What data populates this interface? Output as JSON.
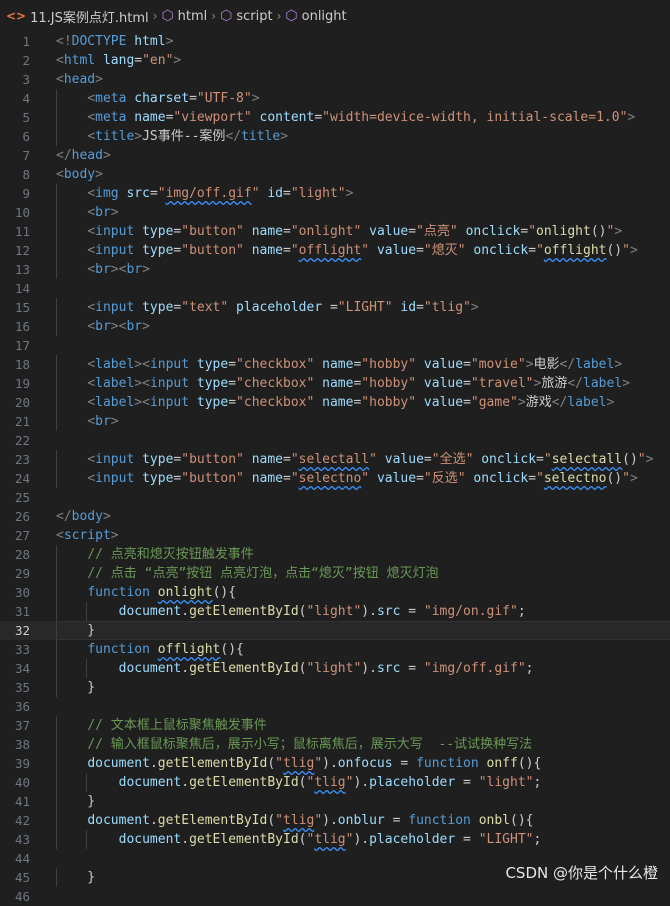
{
  "breadcrumb": {
    "file": "11.JS案例点灯.html",
    "items": [
      "html",
      "script",
      "onlight"
    ]
  },
  "lines": [
    [
      [
        "p",
        "<!"
      ],
      [
        "t",
        "DOCTYPE"
      ],
      [
        "d",
        " "
      ],
      [
        "a",
        "html"
      ],
      [
        "p",
        ">"
      ]
    ],
    [
      [
        "p",
        "<"
      ],
      [
        "t",
        "html"
      ],
      [
        "d",
        " "
      ],
      [
        "a",
        "lang"
      ],
      [
        "d",
        "="
      ],
      [
        "s",
        "\"en\""
      ],
      [
        "p",
        ">"
      ]
    ],
    [
      [
        "p",
        "<"
      ],
      [
        "t",
        "head"
      ],
      [
        "p",
        ">"
      ]
    ],
    [
      [
        "d",
        "    "
      ],
      [
        "p",
        "<"
      ],
      [
        "t",
        "meta"
      ],
      [
        "d",
        " "
      ],
      [
        "a",
        "charset"
      ],
      [
        "d",
        "="
      ],
      [
        "s",
        "\"UTF-8\""
      ],
      [
        "p",
        ">"
      ]
    ],
    [
      [
        "d",
        "    "
      ],
      [
        "p",
        "<"
      ],
      [
        "t",
        "meta"
      ],
      [
        "d",
        " "
      ],
      [
        "a",
        "name"
      ],
      [
        "d",
        "="
      ],
      [
        "s",
        "\"viewport\""
      ],
      [
        "d",
        " "
      ],
      [
        "a",
        "content"
      ],
      [
        "d",
        "="
      ],
      [
        "s",
        "\"width=device-width, initial-scale=1.0\""
      ],
      [
        "p",
        ">"
      ]
    ],
    [
      [
        "d",
        "    "
      ],
      [
        "p",
        "<"
      ],
      [
        "t",
        "title"
      ],
      [
        "p",
        ">"
      ],
      [
        "d",
        "JS事件--案例"
      ],
      [
        "p",
        "</"
      ],
      [
        "t",
        "title"
      ],
      [
        "p",
        ">"
      ]
    ],
    [
      [
        "p",
        "</"
      ],
      [
        "t",
        "head"
      ],
      [
        "p",
        ">"
      ]
    ],
    [
      [
        "p",
        "<"
      ],
      [
        "t",
        "body"
      ],
      [
        "p",
        ">"
      ]
    ],
    [
      [
        "d",
        "    "
      ],
      [
        "p",
        "<"
      ],
      [
        "t",
        "img"
      ],
      [
        "d",
        " "
      ],
      [
        "a",
        "src"
      ],
      [
        "d",
        "="
      ],
      [
        "s",
        "\""
      ],
      [
        "s sq",
        "img/off.gif"
      ],
      [
        "s",
        "\""
      ],
      [
        "d",
        " "
      ],
      [
        "a",
        "id"
      ],
      [
        "d",
        "="
      ],
      [
        "s",
        "\"light\""
      ],
      [
        "p",
        ">"
      ]
    ],
    [
      [
        "d",
        "    "
      ],
      [
        "p",
        "<"
      ],
      [
        "t",
        "br"
      ],
      [
        "p",
        ">"
      ]
    ],
    [
      [
        "d",
        "    "
      ],
      [
        "p",
        "<"
      ],
      [
        "t",
        "input"
      ],
      [
        "d",
        " "
      ],
      [
        "a",
        "type"
      ],
      [
        "d",
        "="
      ],
      [
        "s",
        "\"button\""
      ],
      [
        "d",
        " "
      ],
      [
        "a",
        "name"
      ],
      [
        "d",
        "="
      ],
      [
        "s",
        "\"onlight\""
      ],
      [
        "d",
        " "
      ],
      [
        "a",
        "value"
      ],
      [
        "d",
        "="
      ],
      [
        "s",
        "\"点亮\""
      ],
      [
        "d",
        " "
      ],
      [
        "a",
        "onclick"
      ],
      [
        "d",
        "="
      ],
      [
        "s",
        "\""
      ],
      [
        "f",
        "onlight"
      ],
      [
        "d",
        "()"
      ],
      [
        "s",
        "\""
      ],
      [
        "p",
        ">"
      ]
    ],
    [
      [
        "d",
        "    "
      ],
      [
        "p",
        "<"
      ],
      [
        "t",
        "input"
      ],
      [
        "d",
        " "
      ],
      [
        "a",
        "type"
      ],
      [
        "d",
        "="
      ],
      [
        "s",
        "\"button\""
      ],
      [
        "d",
        " "
      ],
      [
        "a",
        "name"
      ],
      [
        "d",
        "="
      ],
      [
        "s",
        "\""
      ],
      [
        "s sq",
        "offlight"
      ],
      [
        "s",
        "\""
      ],
      [
        "d",
        " "
      ],
      [
        "a",
        "value"
      ],
      [
        "d",
        "="
      ],
      [
        "s",
        "\"熄灭\""
      ],
      [
        "d",
        " "
      ],
      [
        "a",
        "onclick"
      ],
      [
        "d",
        "="
      ],
      [
        "s",
        "\""
      ],
      [
        "f sq",
        "offlight"
      ],
      [
        "d",
        "()"
      ],
      [
        "s",
        "\""
      ],
      [
        "p",
        ">"
      ]
    ],
    [
      [
        "d",
        "    "
      ],
      [
        "p",
        "<"
      ],
      [
        "t",
        "br"
      ],
      [
        "p",
        "><"
      ],
      [
        "t",
        "br"
      ],
      [
        "p",
        ">"
      ]
    ],
    [],
    [
      [
        "d",
        "    "
      ],
      [
        "p",
        "<"
      ],
      [
        "t",
        "input"
      ],
      [
        "d",
        " "
      ],
      [
        "a",
        "type"
      ],
      [
        "d",
        "="
      ],
      [
        "s",
        "\"text\""
      ],
      [
        "d",
        " "
      ],
      [
        "a",
        "placeholder"
      ],
      [
        "d",
        " ="
      ],
      [
        "s",
        "\"LIGHT\""
      ],
      [
        "d",
        " "
      ],
      [
        "a",
        "id"
      ],
      [
        "d",
        "="
      ],
      [
        "s",
        "\"tlig\""
      ],
      [
        "p",
        ">"
      ]
    ],
    [
      [
        "d",
        "    "
      ],
      [
        "p",
        "<"
      ],
      [
        "t",
        "br"
      ],
      [
        "p",
        "><"
      ],
      [
        "t",
        "br"
      ],
      [
        "p",
        ">"
      ]
    ],
    [],
    [
      [
        "d",
        "    "
      ],
      [
        "p",
        "<"
      ],
      [
        "t",
        "label"
      ],
      [
        "p",
        "><"
      ],
      [
        "t",
        "input"
      ],
      [
        "d",
        " "
      ],
      [
        "a",
        "type"
      ],
      [
        "d",
        "="
      ],
      [
        "s",
        "\"checkbox\""
      ],
      [
        "d",
        " "
      ],
      [
        "a",
        "name"
      ],
      [
        "d",
        "="
      ],
      [
        "s",
        "\"hobby\""
      ],
      [
        "d",
        " "
      ],
      [
        "a",
        "value"
      ],
      [
        "d",
        "="
      ],
      [
        "s",
        "\"movie\""
      ],
      [
        "p",
        ">"
      ],
      [
        "d",
        "电影"
      ],
      [
        "p",
        "</"
      ],
      [
        "t",
        "label"
      ],
      [
        "p",
        ">"
      ]
    ],
    [
      [
        "d",
        "    "
      ],
      [
        "p",
        "<"
      ],
      [
        "t",
        "label"
      ],
      [
        "p",
        "><"
      ],
      [
        "t",
        "input"
      ],
      [
        "d",
        " "
      ],
      [
        "a",
        "type"
      ],
      [
        "d",
        "="
      ],
      [
        "s",
        "\"checkbox\""
      ],
      [
        "d",
        " "
      ],
      [
        "a",
        "name"
      ],
      [
        "d",
        "="
      ],
      [
        "s",
        "\"hobby\""
      ],
      [
        "d",
        " "
      ],
      [
        "a",
        "value"
      ],
      [
        "d",
        "="
      ],
      [
        "s",
        "\"travel\""
      ],
      [
        "p",
        ">"
      ],
      [
        "d",
        "旅游"
      ],
      [
        "p",
        "</"
      ],
      [
        "t",
        "label"
      ],
      [
        "p",
        ">"
      ]
    ],
    [
      [
        "d",
        "    "
      ],
      [
        "p",
        "<"
      ],
      [
        "t",
        "label"
      ],
      [
        "p",
        "><"
      ],
      [
        "t",
        "input"
      ],
      [
        "d",
        " "
      ],
      [
        "a",
        "type"
      ],
      [
        "d",
        "="
      ],
      [
        "s",
        "\"checkbox\""
      ],
      [
        "d",
        " "
      ],
      [
        "a",
        "name"
      ],
      [
        "d",
        "="
      ],
      [
        "s",
        "\"hobby\""
      ],
      [
        "d",
        " "
      ],
      [
        "a",
        "value"
      ],
      [
        "d",
        "="
      ],
      [
        "s",
        "\"game\""
      ],
      [
        "p",
        ">"
      ],
      [
        "d",
        "游戏"
      ],
      [
        "p",
        "</"
      ],
      [
        "t",
        "label"
      ],
      [
        "p",
        ">"
      ]
    ],
    [
      [
        "d",
        "    "
      ],
      [
        "p",
        "<"
      ],
      [
        "t",
        "br"
      ],
      [
        "p",
        ">"
      ]
    ],
    [],
    [
      [
        "d",
        "    "
      ],
      [
        "p",
        "<"
      ],
      [
        "t",
        "input"
      ],
      [
        "d",
        " "
      ],
      [
        "a",
        "type"
      ],
      [
        "d",
        "="
      ],
      [
        "s",
        "\"button\""
      ],
      [
        "d",
        " "
      ],
      [
        "a",
        "name"
      ],
      [
        "d",
        "="
      ],
      [
        "s",
        "\""
      ],
      [
        "s sq",
        "selectall"
      ],
      [
        "s",
        "\""
      ],
      [
        "d",
        " "
      ],
      [
        "a",
        "value"
      ],
      [
        "d",
        "="
      ],
      [
        "s",
        "\"全选\""
      ],
      [
        "d",
        " "
      ],
      [
        "a",
        "onclick"
      ],
      [
        "d",
        "="
      ],
      [
        "s",
        "\""
      ],
      [
        "f sq",
        "selectall"
      ],
      [
        "d",
        "()"
      ],
      [
        "s",
        "\""
      ],
      [
        "p",
        ">"
      ]
    ],
    [
      [
        "d",
        "    "
      ],
      [
        "p",
        "<"
      ],
      [
        "t",
        "input"
      ],
      [
        "d",
        " "
      ],
      [
        "a",
        "type"
      ],
      [
        "d",
        "="
      ],
      [
        "s",
        "\"button\""
      ],
      [
        "d",
        " "
      ],
      [
        "a",
        "name"
      ],
      [
        "d",
        "="
      ],
      [
        "s",
        "\""
      ],
      [
        "s sq",
        "selectno"
      ],
      [
        "s",
        "\""
      ],
      [
        "d",
        " "
      ],
      [
        "a",
        "value"
      ],
      [
        "d",
        "="
      ],
      [
        "s",
        "\"反选\""
      ],
      [
        "d",
        " "
      ],
      [
        "a",
        "onclick"
      ],
      [
        "d",
        "="
      ],
      [
        "s",
        "\""
      ],
      [
        "f sq",
        "selectno"
      ],
      [
        "d",
        "()"
      ],
      [
        "s",
        "\""
      ],
      [
        "p",
        ">"
      ]
    ],
    [],
    [
      [
        "p",
        "</"
      ],
      [
        "t",
        "body"
      ],
      [
        "p",
        ">"
      ]
    ],
    [
      [
        "p",
        "<"
      ],
      [
        "t",
        "script"
      ],
      [
        "p",
        ">"
      ]
    ],
    [
      [
        "d",
        "    "
      ],
      [
        "c",
        "// 点亮和熄灭按钮触发事件"
      ]
    ],
    [
      [
        "d",
        "    "
      ],
      [
        "c",
        "// 点击 “点亮”按钮 点亮灯泡，点击“熄灭”按钮 熄灭灯泡"
      ]
    ],
    [
      [
        "d",
        "    "
      ],
      [
        "k",
        "function"
      ],
      [
        "d",
        " "
      ],
      [
        "f sq",
        "onlight"
      ],
      [
        "d",
        "(){"
      ]
    ],
    [
      [
        "d",
        "        "
      ],
      [
        "a",
        "document"
      ],
      [
        "d",
        "."
      ],
      [
        "f",
        "getElementById"
      ],
      [
        "d",
        "("
      ],
      [
        "s",
        "\"light\""
      ],
      [
        "d",
        ")."
      ],
      [
        "a",
        "src"
      ],
      [
        "d",
        " = "
      ],
      [
        "s",
        "\"img/on.gif\""
      ],
      [
        "d",
        ";"
      ]
    ],
    [
      [
        "d",
        "    }"
      ]
    ],
    [
      [
        "d",
        "    "
      ],
      [
        "k",
        "function"
      ],
      [
        "d",
        " "
      ],
      [
        "f sq",
        "offlight"
      ],
      [
        "d",
        "(){"
      ]
    ],
    [
      [
        "d",
        "        "
      ],
      [
        "a",
        "document"
      ],
      [
        "d",
        "."
      ],
      [
        "f",
        "getElementById"
      ],
      [
        "d",
        "("
      ],
      [
        "s",
        "\"light\""
      ],
      [
        "d",
        ")."
      ],
      [
        "a",
        "src"
      ],
      [
        "d",
        " = "
      ],
      [
        "s",
        "\"img/off.gif\""
      ],
      [
        "d",
        ";"
      ]
    ],
    [
      [
        "d",
        "    }"
      ]
    ],
    [],
    [
      [
        "d",
        "    "
      ],
      [
        "c",
        "// 文本框上鼠标聚焦触发事件"
      ]
    ],
    [
      [
        "d",
        "    "
      ],
      [
        "c",
        "// 输入框鼠标聚焦后，展示小写；鼠标离焦后，展示大写  --试试换种写法"
      ]
    ],
    [
      [
        "d",
        "    "
      ],
      [
        "a",
        "document"
      ],
      [
        "d",
        "."
      ],
      [
        "f",
        "getElementById"
      ],
      [
        "d",
        "("
      ],
      [
        "s",
        "\""
      ],
      [
        "s sq",
        "tlig"
      ],
      [
        "s",
        "\""
      ],
      [
        "d",
        ")."
      ],
      [
        "a",
        "onfocus"
      ],
      [
        "d",
        " = "
      ],
      [
        "k",
        "function"
      ],
      [
        "d",
        " "
      ],
      [
        "f",
        "onff"
      ],
      [
        "d",
        "(){"
      ]
    ],
    [
      [
        "d",
        "        "
      ],
      [
        "a",
        "document"
      ],
      [
        "d",
        "."
      ],
      [
        "f",
        "getElementById"
      ],
      [
        "d",
        "("
      ],
      [
        "s",
        "\""
      ],
      [
        "s sq",
        "tlig"
      ],
      [
        "s",
        "\""
      ],
      [
        "d",
        ")."
      ],
      [
        "a",
        "placeholder"
      ],
      [
        "d",
        " = "
      ],
      [
        "s",
        "\"light\""
      ],
      [
        "d",
        ";"
      ]
    ],
    [
      [
        "d",
        "    }"
      ]
    ],
    [
      [
        "d",
        "    "
      ],
      [
        "a",
        "document"
      ],
      [
        "d",
        "."
      ],
      [
        "f",
        "getElementById"
      ],
      [
        "d",
        "("
      ],
      [
        "s",
        "\""
      ],
      [
        "s sq",
        "tlig"
      ],
      [
        "s",
        "\""
      ],
      [
        "d",
        ")."
      ],
      [
        "a",
        "onblur"
      ],
      [
        "d",
        " = "
      ],
      [
        "k",
        "function"
      ],
      [
        "d",
        " "
      ],
      [
        "f",
        "onbl"
      ],
      [
        "d",
        "(){"
      ]
    ],
    [
      [
        "d",
        "        "
      ],
      [
        "a",
        "document"
      ],
      [
        "d",
        "."
      ],
      [
        "f",
        "getElementById"
      ],
      [
        "d",
        "("
      ],
      [
        "s",
        "\""
      ],
      [
        "s sq",
        "tlig"
      ],
      [
        "s",
        "\""
      ],
      [
        "d",
        ")."
      ],
      [
        "a",
        "placeholder"
      ],
      [
        "d",
        " = "
      ],
      [
        "s",
        "\"LIGHT\""
      ],
      [
        "d",
        ";"
      ]
    ],
    [],
    [
      [
        "d",
        "    }"
      ]
    ],
    []
  ],
  "current_line": 32,
  "watermark": "CSDN @你是个什么橙"
}
